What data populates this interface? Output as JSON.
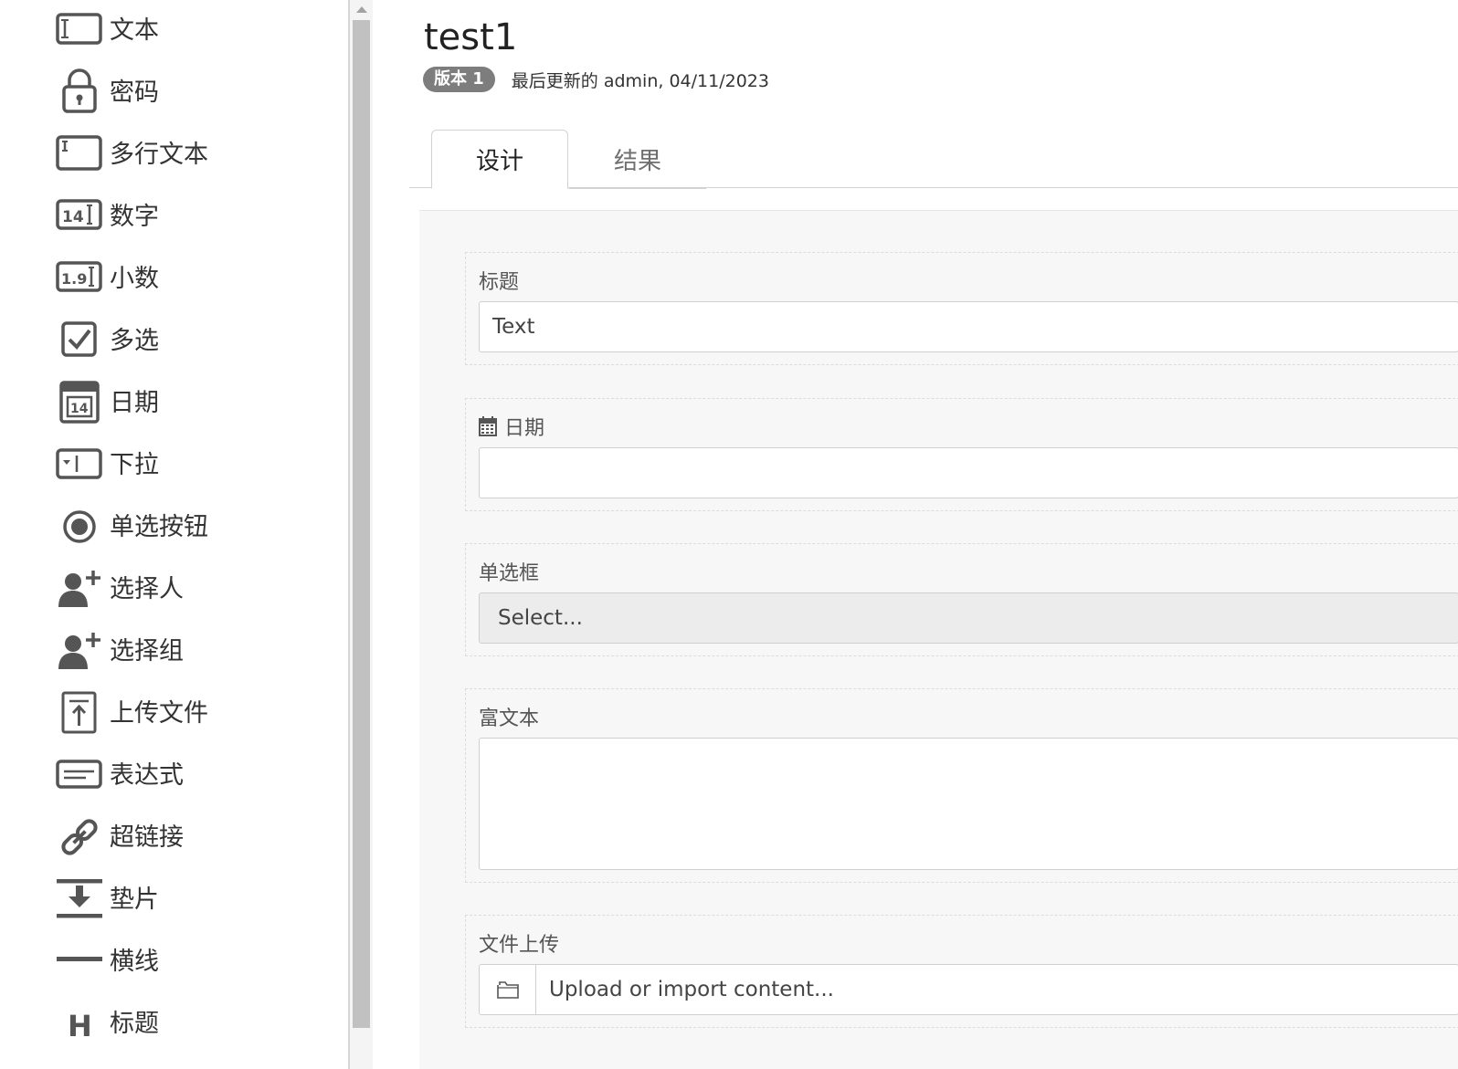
{
  "sidebar": {
    "items": [
      {
        "icon": "text-field-icon",
        "label": "文本"
      },
      {
        "icon": "lock-icon",
        "label": "密码"
      },
      {
        "icon": "multiline-text-icon",
        "label": "多行文本"
      },
      {
        "icon": "number-icon",
        "label": "数字"
      },
      {
        "icon": "decimal-icon",
        "label": "小数"
      },
      {
        "icon": "checkbox-icon",
        "label": "多选"
      },
      {
        "icon": "calendar-icon",
        "label": "日期"
      },
      {
        "icon": "dropdown-icon",
        "label": "下拉"
      },
      {
        "icon": "radio-icon",
        "label": "单选按钮"
      },
      {
        "icon": "add-user-icon",
        "label": "选择人"
      },
      {
        "icon": "add-group-icon",
        "label": "选择组"
      },
      {
        "icon": "upload-file-icon",
        "label": "上传文件"
      },
      {
        "icon": "expression-icon",
        "label": "表达式"
      },
      {
        "icon": "link-icon",
        "label": "超链接"
      },
      {
        "icon": "spacer-icon",
        "label": "垫片"
      },
      {
        "icon": "horizontal-line-icon",
        "label": "横线"
      },
      {
        "icon": "heading-icon",
        "label": "标题"
      }
    ]
  },
  "header": {
    "title": "test1",
    "version_badge": "版本 1",
    "updated_text": "最后更新的 admin, 04/11/2023"
  },
  "tabs": [
    {
      "label": "设计",
      "active": true
    },
    {
      "label": "结果",
      "active": false
    }
  ],
  "form": {
    "title_field": {
      "label": "标题",
      "value": "Text"
    },
    "date_field": {
      "label": "日期",
      "value": ""
    },
    "select_field": {
      "label": "单选框",
      "placeholder": "Select..."
    },
    "richtext_field": {
      "label": "富文本"
    },
    "upload_field": {
      "label": "文件上传",
      "placeholder": "Upload or import content..."
    }
  }
}
